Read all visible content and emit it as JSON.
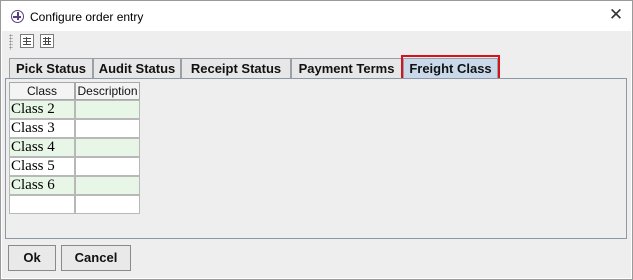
{
  "window": {
    "title": "Configure order entry",
    "close_glyph": "✕"
  },
  "toolbar": {
    "buttons": [
      {
        "icon": "insert-row-icon"
      },
      {
        "icon": "table-settings-icon"
      }
    ]
  },
  "tabs": [
    {
      "label": "Pick Status",
      "active": false
    },
    {
      "label": "Audit Status",
      "active": false
    },
    {
      "label": "Receipt Status",
      "active": false
    },
    {
      "label": "Payment Terms",
      "active": false
    },
    {
      "label": "Freight Class",
      "active": true
    }
  ],
  "table": {
    "columns": [
      "Class",
      "Description"
    ],
    "rows": [
      {
        "class": "Class 2",
        "description": ""
      },
      {
        "class": "Class 3",
        "description": ""
      },
      {
        "class": "Class 4",
        "description": ""
      },
      {
        "class": "Class 5",
        "description": ""
      },
      {
        "class": "Class 6",
        "description": ""
      },
      {
        "class": "",
        "description": ""
      }
    ],
    "row_colors": [
      "#e8f6e8",
      "#ffffff"
    ]
  },
  "buttons": {
    "ok_label": "Ok",
    "cancel_label": "Cancel"
  },
  "colors": {
    "highlight": "#d8121b",
    "active_tab": "#c9d9ea"
  }
}
